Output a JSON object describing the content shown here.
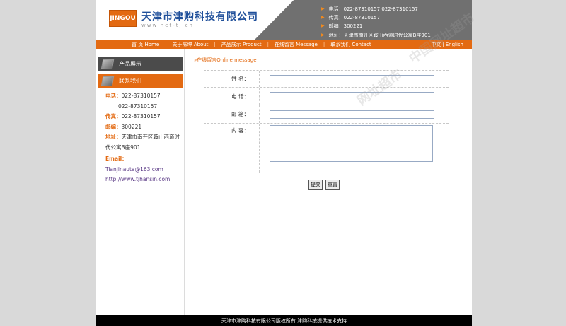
{
  "header": {
    "logo_text": "JINGOU",
    "company_name": "天津市津购科技有限公司",
    "company_url": "www.net-tj.cn",
    "contacts": [
      "电话：022-87310157  022-87310157",
      "传真：022-87310157",
      "邮编：300221",
      "地址：天津市南开区鞍山西道时代公寓B座901"
    ]
  },
  "nav": {
    "items": [
      "首 页  Home",
      "关于陈坤  About",
      "产品展示  Product",
      "在线留言  Message",
      "联系我们  Contact"
    ],
    "lang_cn": "中文",
    "lang_sep": "|",
    "lang_en": "English"
  },
  "sidebar": {
    "products_label": "产品展示",
    "contact_label": "联系我们",
    "tel_label": "电话：",
    "tel1": "022-87310157",
    "tel2": "022-87310157",
    "fax_label": "传真：",
    "fax": "022-87310157",
    "zip_label": "邮编：",
    "zip": "300221",
    "addr_label": "地址：",
    "addr": "天津市南开区鞍山西道时代公寓B座901",
    "email_label": "Email：",
    "email": "Tianjinauta@163.com",
    "website": "http://www.tjhansin.com"
  },
  "main": {
    "breadcrumb": "»在线留言Online message",
    "name_label": "姓  名：",
    "phone_label": "电  话：",
    "email_label": "邮  箱：",
    "content_label": "内  容：",
    "name_value": "",
    "phone_value": "",
    "email_value": "",
    "content_value": "",
    "submit_label": "提交",
    "reset_label": "重置"
  },
  "footer": {
    "text": "天津市津购科技有限公司版权所有  津购科技提供技术支持"
  },
  "watermark": {
    "text1": "中国网址超市",
    "text2": "网址超市"
  },
  "colors": {
    "accent": "#e36a12",
    "brand_blue": "#1f4f9a",
    "header_gray": "#707070"
  }
}
